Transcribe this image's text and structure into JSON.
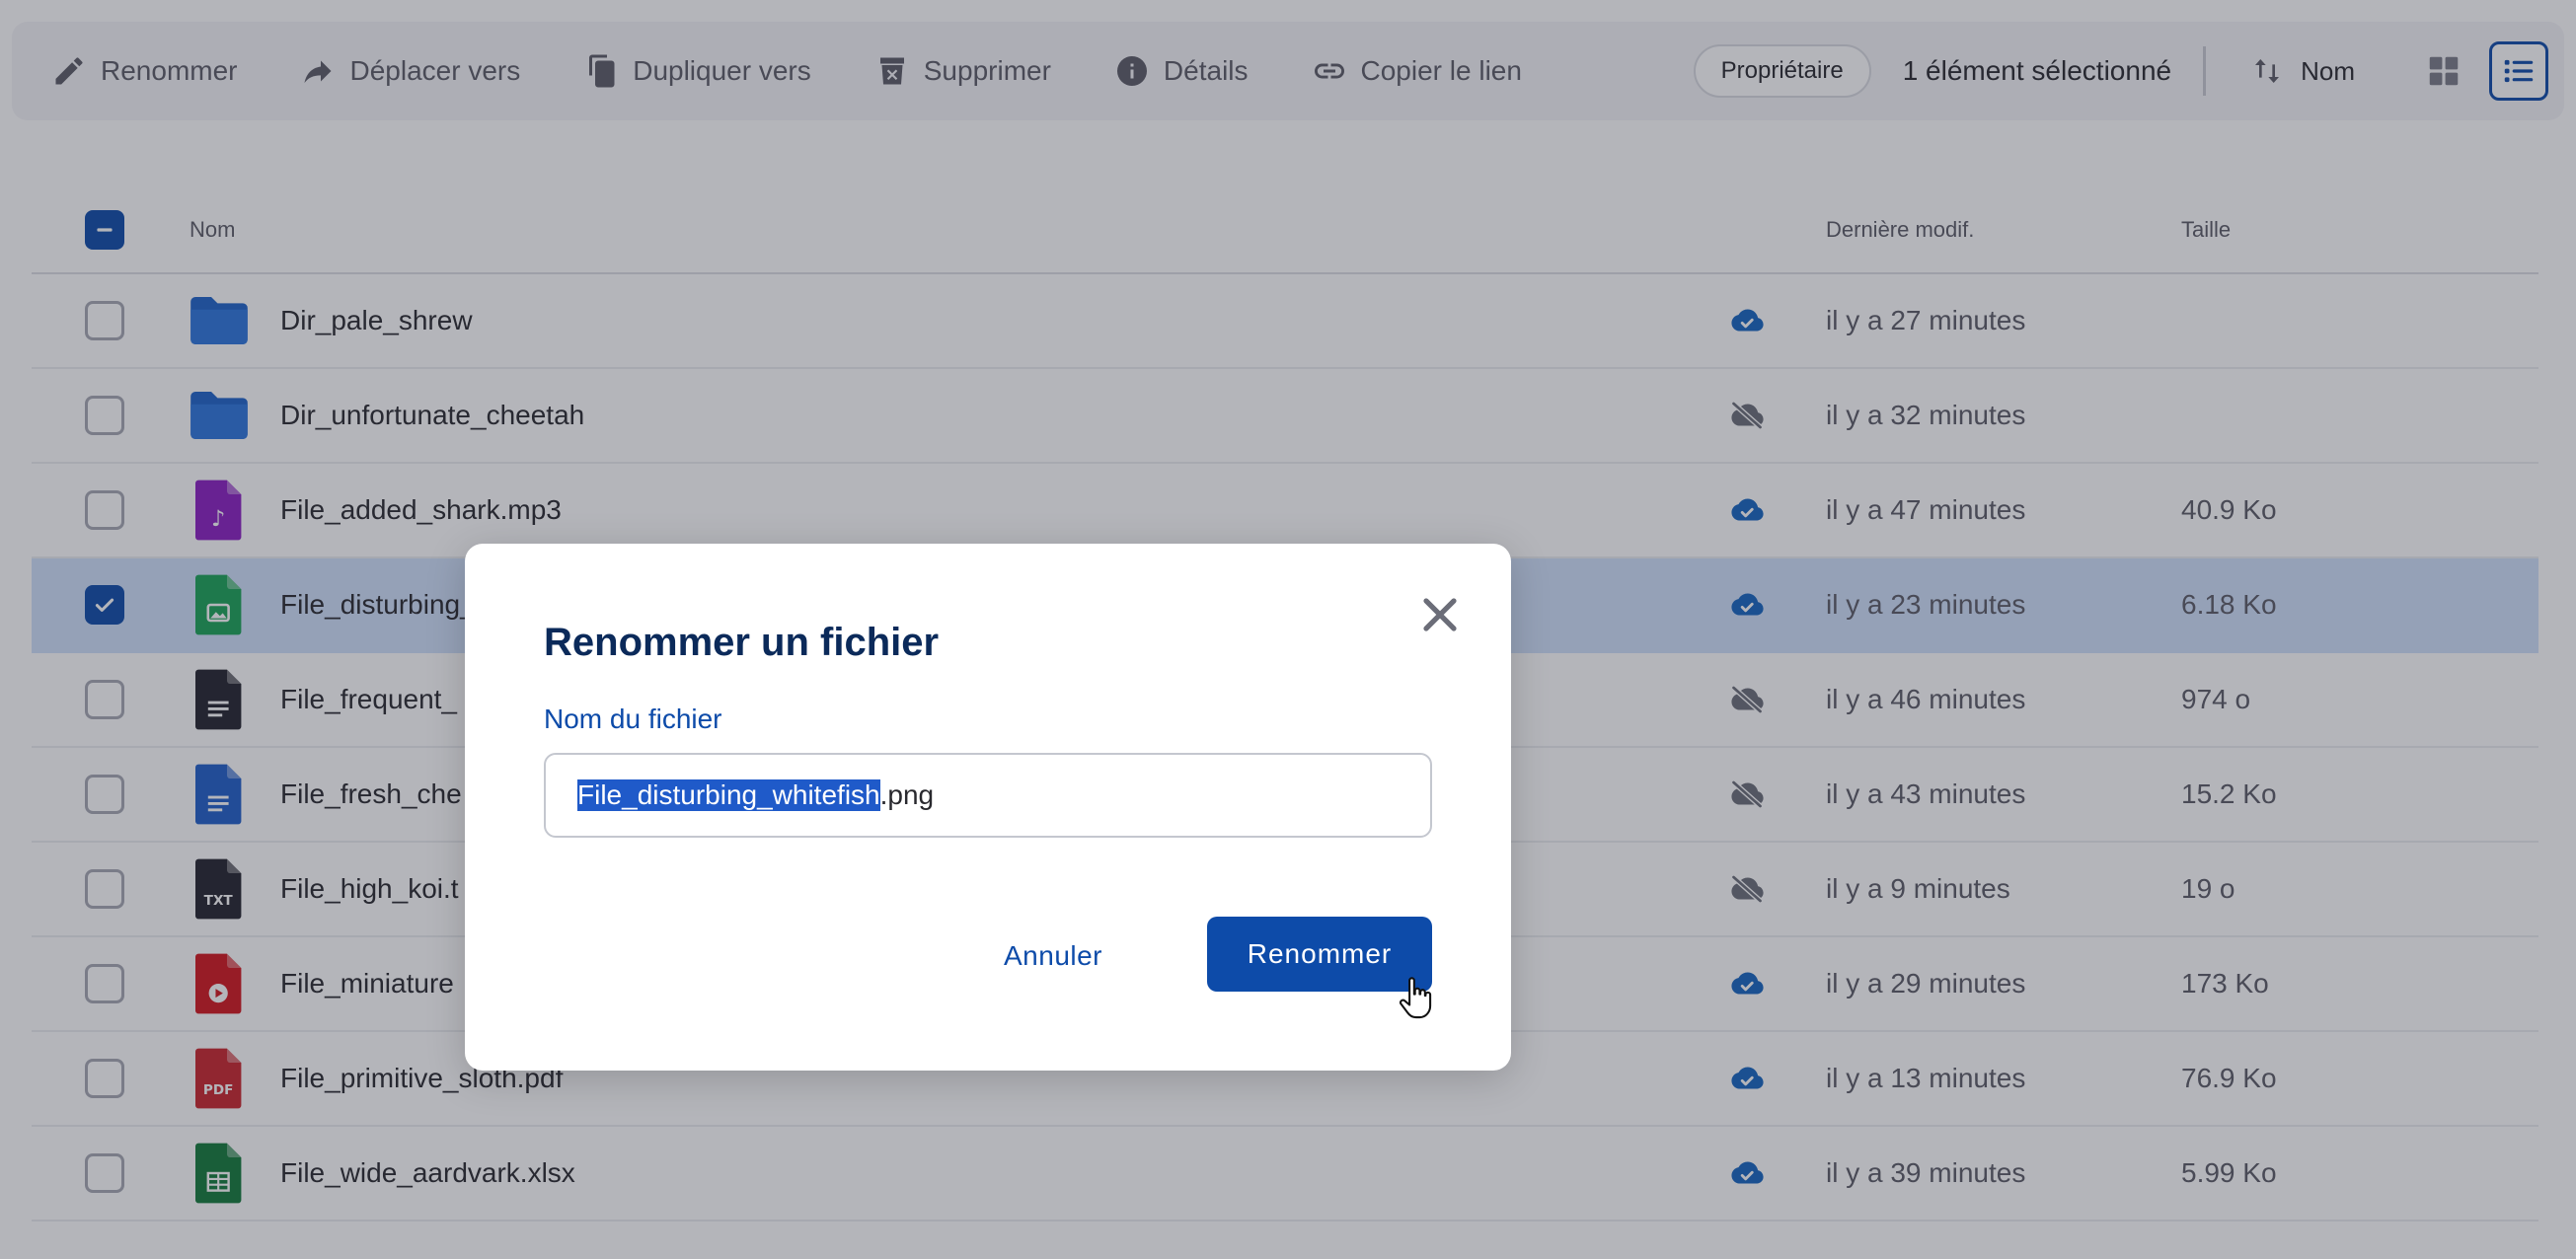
{
  "toolbar": {
    "rename": "Renommer",
    "move": "Déplacer vers",
    "duplicate": "Dupliquer vers",
    "delete": "Supprimer",
    "details": "Détails",
    "copy_link": "Copier le lien",
    "owner_chip": "Propriétaire",
    "selection_count": "1 élément sélectionné",
    "sort_label": "Nom"
  },
  "table": {
    "headers": {
      "name": "Nom",
      "modified": "Dernière modif.",
      "size": "Taille"
    },
    "rows": [
      {
        "name": "Dir_pale_shrew",
        "type": "folder",
        "synced": true,
        "modified": "il y a 27 minutes",
        "size": ""
      },
      {
        "name": "Dir_unfortunate_cheetah",
        "type": "folder",
        "synced": false,
        "modified": "il y a 32 minutes",
        "size": ""
      },
      {
        "name": "File_added_shark.mp3",
        "type": "audio",
        "synced": true,
        "modified": "il y a 47 minutes",
        "size": "40.9 Ko"
      },
      {
        "name": "File_disturbing_",
        "type": "image",
        "synced": true,
        "modified": "il y a 23 minutes",
        "size": "6.18 Ko",
        "selected": true
      },
      {
        "name": "File_frequent_",
        "type": "text",
        "synced": false,
        "modified": "il y a 46 minutes",
        "size": "974 o"
      },
      {
        "name": "File_fresh_che",
        "type": "doc",
        "synced": false,
        "modified": "il y a 43 minutes",
        "size": "15.2 Ko"
      },
      {
        "name": "File_high_koi.t",
        "type": "txt",
        "synced": false,
        "modified": "il y a 9 minutes",
        "size": "19 o"
      },
      {
        "name": "File_miniature",
        "type": "video",
        "synced": true,
        "modified": "il y a 29 minutes",
        "size": "173 Ko"
      },
      {
        "name": "File_primitive_sloth.pdf",
        "type": "pdf",
        "synced": true,
        "modified": "il y a 13 minutes",
        "size": "76.9 Ko"
      },
      {
        "name": "File_wide_aardvark.xlsx",
        "type": "sheet",
        "synced": true,
        "modified": "il y a 39 minutes",
        "size": "5.99 Ko"
      }
    ]
  },
  "modal": {
    "title": "Renommer un fichier",
    "field_label": "Nom du fichier",
    "value_selected": "File_disturbing_whitefish",
    "value_ext": ".png",
    "cancel": "Annuler",
    "confirm": "Renommer"
  },
  "icons": {
    "txt_label": "TXT",
    "pdf_label": "PDF",
    "audio_glyph": "♪"
  },
  "colors": {
    "accent": "#0d4ba9",
    "folder": "#1e63c9",
    "audio": "#8a1ec2",
    "image": "#1aa356",
    "text": "#23232d",
    "doc": "#1f5fc9",
    "video": "#d3141c",
    "pdf": "#c9242b",
    "sheet": "#127a3a",
    "sync": "#1565c0",
    "nosync": "#6b6d78"
  }
}
